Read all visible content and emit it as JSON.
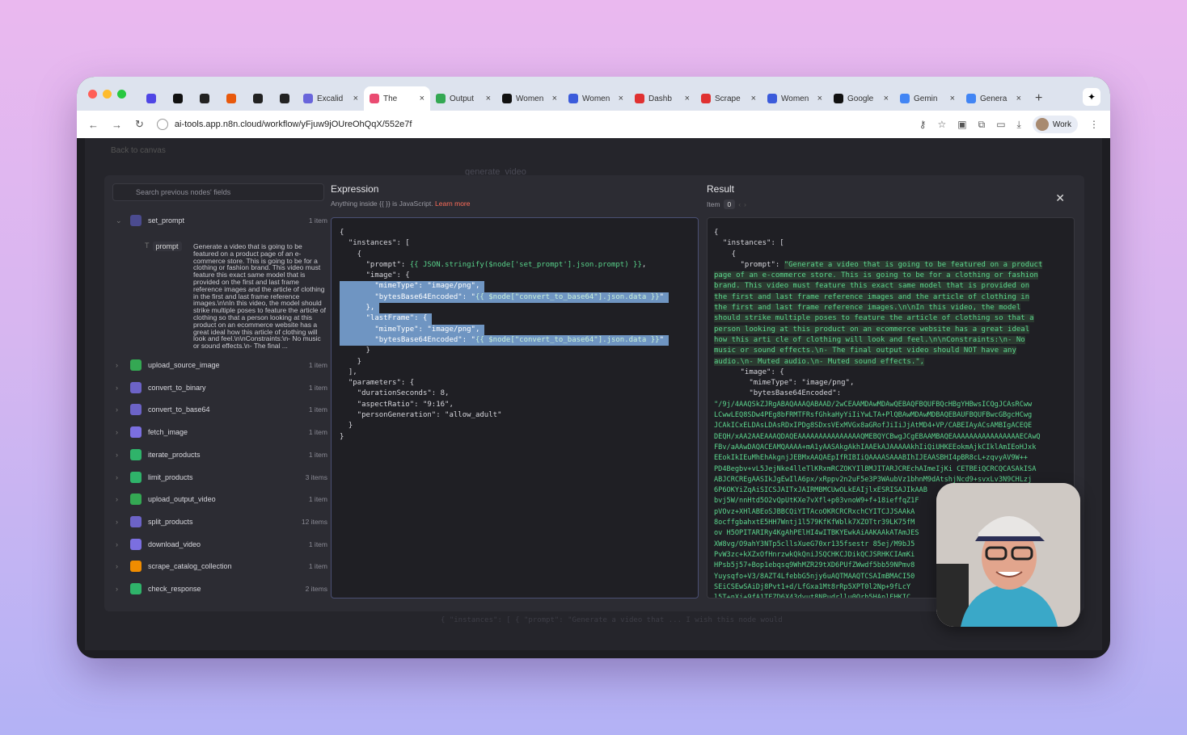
{
  "browser": {
    "tabs": [
      {
        "label": "",
        "color": "#4f46e5"
      },
      {
        "label": "",
        "color": "#111111"
      },
      {
        "label": "",
        "color": "#222222"
      },
      {
        "label": "",
        "color": "#e8590c"
      },
      {
        "label": "",
        "color": "#222222"
      },
      {
        "label": "",
        "color": "#222222"
      },
      {
        "label": "Excalid",
        "color": "#6965db"
      },
      {
        "label": "The",
        "color": "#ea4b71"
      },
      {
        "label": "Output",
        "color": "#34a853"
      },
      {
        "label": "Women",
        "color": "#111111"
      },
      {
        "label": "Women",
        "color": "#3b5bdb"
      },
      {
        "label": "Dashb",
        "color": "#e03131"
      },
      {
        "label": "Scrape",
        "color": "#e03131"
      },
      {
        "label": "Women",
        "color": "#3b5bdb"
      },
      {
        "label": "Google",
        "color": "#111111"
      },
      {
        "label": "Gemin",
        "color": "#4285f4"
      },
      {
        "label": "Genera",
        "color": "#4285f4"
      }
    ],
    "url": "ai-tools.app.n8n.cloud/workflow/yFjuw9jOUreOhQqX/552e7f",
    "profile_label": "Work"
  },
  "canvas": {
    "back_label": "Back to canvas",
    "ghost_node": "generate_video",
    "ghost_bottom": "{ \"instances\": [   {    \"prompt\": \"Generate a video that ...     I wish this node would"
  },
  "left_panel": {
    "search_placeholder": "Search previous nodes' fields",
    "expanded_node": {
      "name": "set_prompt",
      "count": "1 item"
    },
    "prompt_field_label": "prompt",
    "prompt_value": "Generate a video that is going to be featured on a product page of an e-commerce store. This is going to be for a clothing or fashion brand. This video must feature this exact same model that is provided on the first and last frame reference images and the article of clothing in the first and last frame reference images.\\n\\nIn this video, the model should strike multiple poses to feature the article of clothing so that a person looking at this product on an ecommerce website has a great ideal how this article of clothing will look and feel.\\n\\nConstraints:\\n- No music or sound effects.\\n- The final ...",
    "nodes": [
      {
        "name": "upload_source_image",
        "count": "1 item",
        "color": "#34a853"
      },
      {
        "name": "convert_to_binary",
        "count": "1 item",
        "color": "#6c63c7"
      },
      {
        "name": "convert_to_base64",
        "count": "1 item",
        "color": "#6c63c7"
      },
      {
        "name": "fetch_image",
        "count": "1 item",
        "color": "#7b6fe0"
      },
      {
        "name": "iterate_products",
        "count": "1 item",
        "color": "#2fb36a"
      },
      {
        "name": "limit_products",
        "count": "3 items",
        "color": "#2fb36a"
      },
      {
        "name": "upload_output_video",
        "count": "1 item",
        "color": "#34a853"
      },
      {
        "name": "split_products",
        "count": "12 items",
        "color": "#6c63c7"
      },
      {
        "name": "download_video",
        "count": "1 item",
        "color": "#7b6fe0"
      },
      {
        "name": "scrape_catalog_collection",
        "count": "1 item",
        "color": "#f08c00"
      },
      {
        "name": "check_response",
        "count": "2 items",
        "color": "#2fb36a"
      }
    ]
  },
  "expression": {
    "title": "Expression",
    "subtitle_prefix": "Anything inside {{ }} is JavaScript.",
    "learn_more": "Learn more",
    "lines": [
      {
        "text": "{",
        "hl": false
      },
      {
        "text": "  \"instances\": [",
        "hl": false
      },
      {
        "text": "    {",
        "hl": false
      },
      {
        "pre": "      \"prompt\": ",
        "tmpl": "{{ JSON.stringify($node['set_prompt'].json.prompt) }}",
        "post": ",",
        "hl": false
      },
      {
        "text": "      \"image\": {",
        "hl": false
      },
      {
        "text": "        \"mimeType\": \"image/png\",",
        "hl": true
      },
      {
        "pre": "        \"bytesBase64Encoded\": \"",
        "tmpl": "{{ $node[\"convert_to_base64\"].json.data }}",
        "post": "\"",
        "hl": true
      },
      {
        "text": "      },",
        "hl": true
      },
      {
        "text": "      \"lastFrame\": {",
        "hl": true
      },
      {
        "text": "        \"mimeType\": \"image/png\",",
        "hl": true
      },
      {
        "pre": "        \"bytesBase64Encoded\": \"",
        "tmpl": "{{ $node[\"convert_to_base64\"].json.data }}",
        "post": "\"",
        "hl": true
      },
      {
        "text": "      }",
        "hl": false
      },
      {
        "text": "    }",
        "hl": false
      },
      {
        "text": "  ],",
        "hl": false
      },
      {
        "text": "  \"parameters\": {",
        "hl": false
      },
      {
        "text": "    \"durationSeconds\": 8,",
        "hl": false
      },
      {
        "text": "    \"aspectRatio\": \"9:16\",",
        "hl": false
      },
      {
        "text": "    \"personGeneration\": \"allow_adult\"",
        "hl": false
      },
      {
        "text": "  }",
        "hl": false
      },
      {
        "text": "}",
        "hl": false
      }
    ]
  },
  "result": {
    "title": "Result",
    "item_label": "Item",
    "item_index": "0",
    "head_lines": [
      "{",
      "  \"instances\": [",
      "    {"
    ],
    "prompt_key": "      \"prompt\": ",
    "prompt_wrapped": [
      "\"Generate a video that is going to be featured on a product",
      "page of an e-commerce store. This is going to be for a clothing or fashion",
      "brand. This video must feature this exact same model that is provided on",
      "the first and last frame reference images and the article of clothing in",
      "the first and last frame reference images.\\n\\nIn this video, the model",
      "should strike multiple poses to feature the article of clothing so that a",
      "person looking at this product on an ecommerce website has a great ideal",
      "how this arti cle of clothing will look and feel.\\n\\nConstraints:\\n- No",
      "music or sound effects.\\n- The final output video should NOT have any",
      "audio.\\n- Muted audio.\\n- Muted sound effects.\","
    ],
    "after_lines": [
      "      \"image\": {",
      "        \"mimeType\": \"image/png\",",
      "        \"bytesBase64Encoded\":"
    ],
    "b64_lines": [
      "\"/9j/4AAQSkZJRgABAQAAAQABAAD/2wCEAAMDAwMDAwQEBAQFBQUFBQcHBgYHBwsICQgJCAsRCww",
      "LCwwLEQ8SDw4PEg8bFRMTFRsfGhkaHyYiIiYwLTA+PlQBAwMDAwMDBAQEBAUFBQUFBwcGBgcHCwg",
      "JCAkICxELDAsLDAsRDxIPDg8SDxsVExMVGx8aGRofJiIiJjAtMD4+VP/CABEIAyACsAMBIgACEQE",
      "DEQH/xAA2AAEAAAQDAQEAAAAAAAAAAAAAAAQMEBQYCBwgJCgEBAAMBAQEAAAAAAAAAAAAAAAAECAwQ",
      "FBv/aAAwDAQACEAMQAAAA+mA1yAASAkgAkhIAAEkAJAAAAAkhIiQiUHKEEokmAjkCIklAmIEoHJxk",
      "EEokIkIEuMhEhAkgnjJEBMxAAQAEpIfRIBIiQAAAASAAABIhIJEAASBHI4pBR8cL+zqvyAV9W++",
      "PD4Begbv+vL5JejNke4lleTlKRxmRCZOKYIlBMJITARJCREchAImeIjKi CETBEiQCRCQCASAkISA",
      "ABJCRCREgAASIkJgEwIlA6px/xRppv2n2uF5e3P3WAubVz1bhnM9dAtshjNcd9+svxLv3N9CHLzj",
      "6P6OKYiZqAiSICSJAITxJAIRMBMCUwOLkEAIjlxESRISAJIkAAB",
      "bvj5W/nnHtd5O2vQpUtKXe7vXfl+p03vnoW9+f+18ieffqZ1F",
      "pVOvz+XHlABEoSJBBCQiYITAcoOKRCRCRxchCYITCJJSAAkA",
      "8ocffgbahxtE5HH7Wntj1l579KfKfWblk7XZOTtr39LK75fM",
      "ov H5OPITARIRy4KgAhPElHI4wITBKYEwkAiAAKAAkATAmJES",
      "XW8vg/O9ahY3NTp5cllsXueG70xr135fsestr 85ej/M9bJ5",
      "PvW3zc+kXZxOfHnrzwkQkQniJSQCHKCJDikQCJSRHKCIAmKi",
      "HPsb5j57+Bop1ebqsq9WhMZR29tXD6PUfZWwdf5bb59NPmv8",
      "Yuysqfo+V3/8AZT4LfebbG5njy6uAQTMAAQTCSAImBMACI50",
      "SEiCSEwSAiDj8Pvt1+d/LfGxa1Mt8rRp5XPT0l2Np+9fLcY",
      "l5T+nXj+9fA1TFZD6X43dvut8NPudrllu0Orh5HAnlEHKIC"
    ]
  }
}
